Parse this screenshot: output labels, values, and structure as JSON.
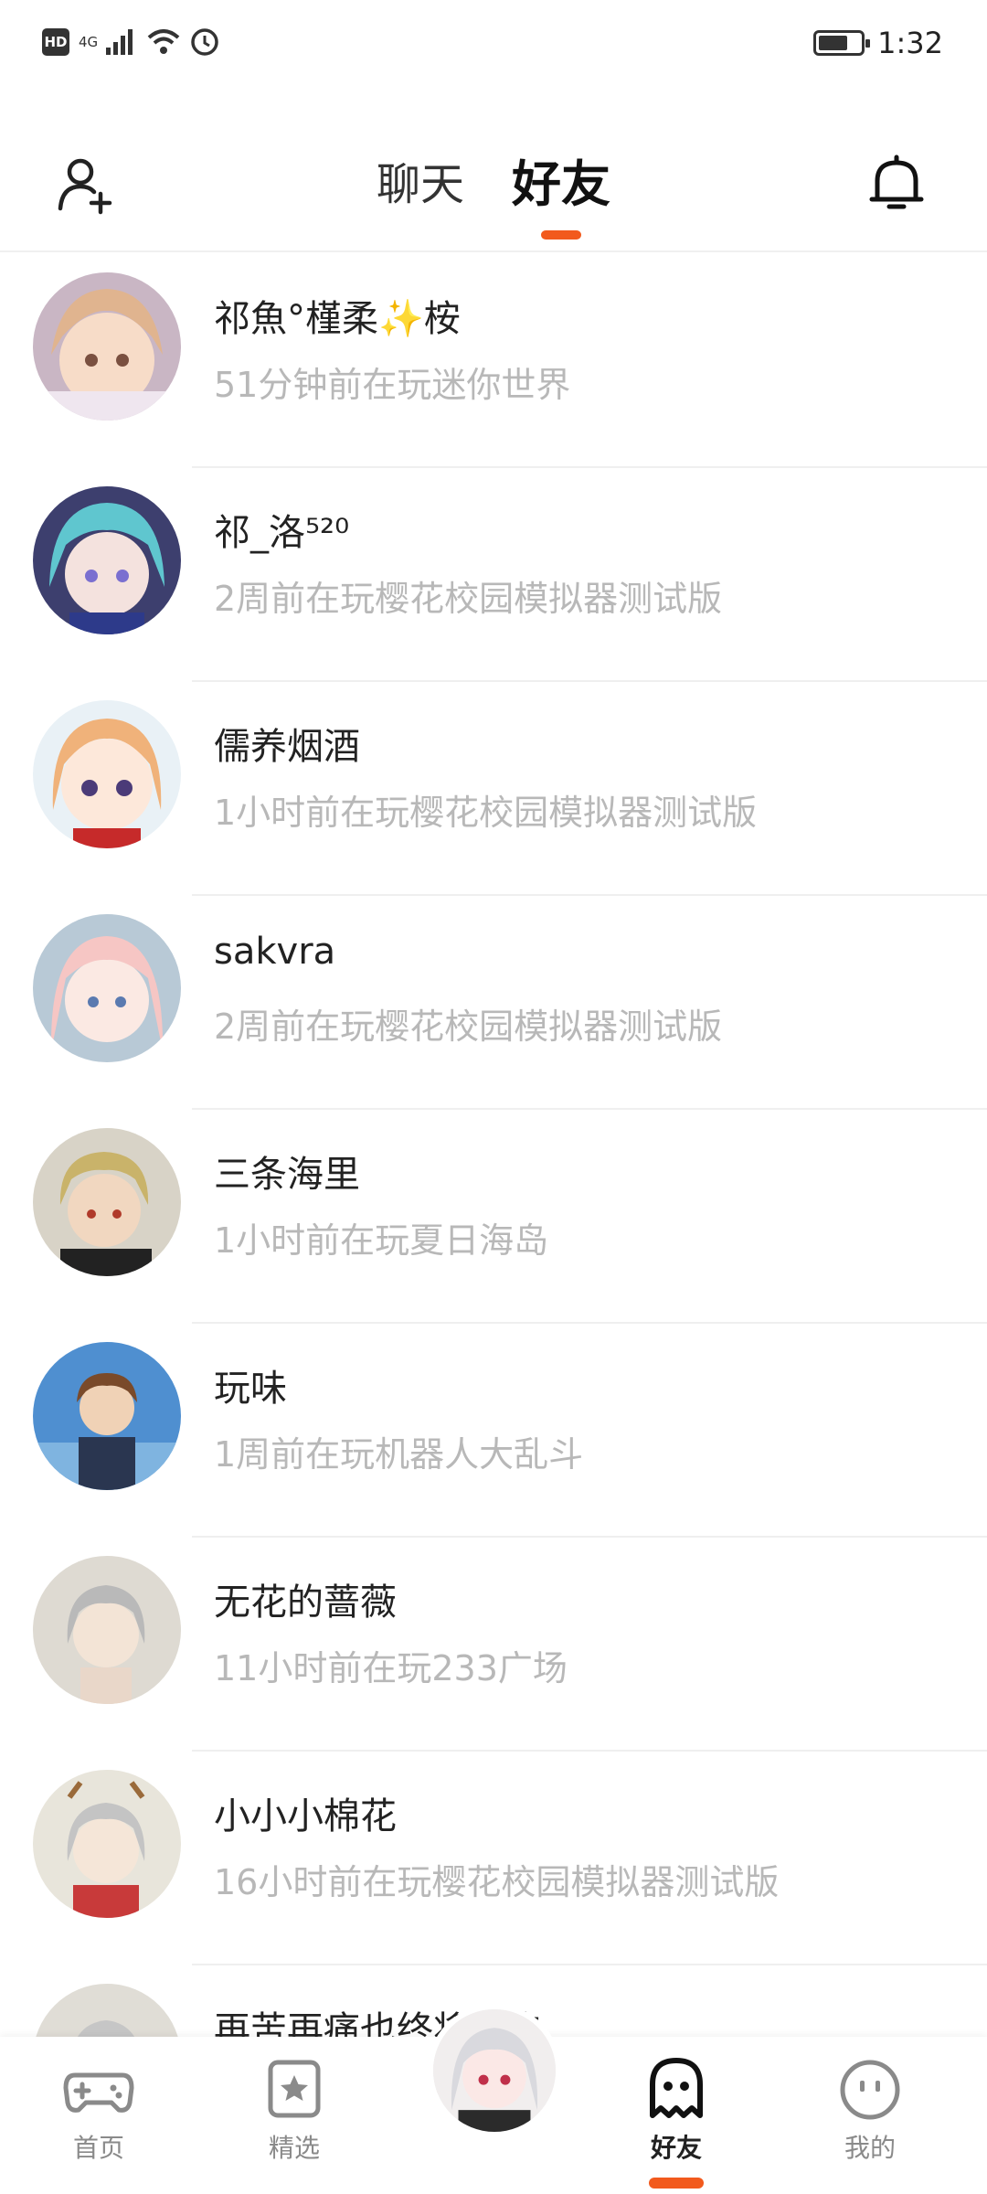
{
  "status_bar": {
    "hd_label": "HD",
    "network_label": "4G",
    "time": "1:32",
    "battery_level": 0.7
  },
  "header": {
    "tabs": [
      {
        "label": "聊天",
        "active": false
      },
      {
        "label": "好友",
        "active": true
      }
    ],
    "accent_color": "#f25a1d"
  },
  "friends": [
    {
      "name": "祁魚°槿柔✨桉",
      "status": "51分钟前在玩迷你世界"
    },
    {
      "name": "祁_洛⁵²⁰",
      "status": "2周前在玩樱花校园模拟器测试版"
    },
    {
      "name": "儒养烟酒",
      "status": "1小时前在玩樱花校园模拟器测试版"
    },
    {
      "name": "sakvra",
      "status": "2周前在玩樱花校园模拟器测试版"
    },
    {
      "name": "三条海里",
      "status": "1小时前在玩夏日海岛"
    },
    {
      "name": "玩味",
      "status": "1周前在玩机器人大乱斗"
    },
    {
      "name": "无花的蔷薇",
      "status": "11小时前在玩233广场"
    },
    {
      "name": "小小小棉花",
      "status": "16小时前在玩樱花校园模拟器测试版"
    },
    {
      "name": "再苦再痛也终将过去",
      "status": ""
    }
  ],
  "bottom_nav": {
    "items": [
      {
        "label": "首页",
        "icon": "gamepad-icon"
      },
      {
        "label": "精选",
        "icon": "star-card-icon"
      },
      {
        "label": "",
        "icon": "center-avatar"
      },
      {
        "label": "好友",
        "icon": "ghost-icon"
      },
      {
        "label": "我的",
        "icon": "face-icon"
      }
    ]
  }
}
